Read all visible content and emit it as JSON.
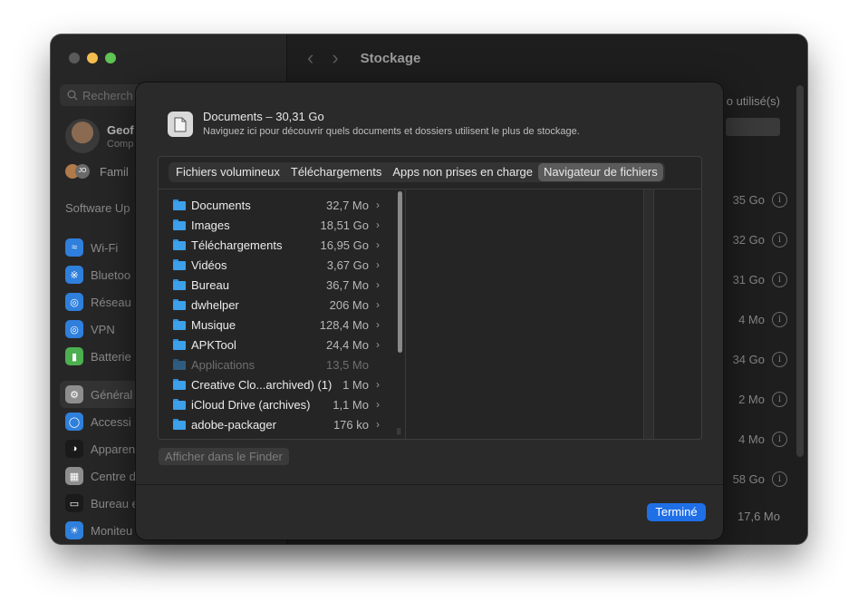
{
  "window": {
    "title": "Stockage"
  },
  "sidebar": {
    "search_placeholder": "Recherch",
    "profile_name": "Geof",
    "profile_sub": "Comp",
    "family_label": "Famil",
    "family_initials": "JO",
    "software_update": "Software Up",
    "items": [
      {
        "label": "Wi-Fi",
        "icon": "wifi-icon",
        "color": "#2f7fdc"
      },
      {
        "label": "Bluetoo",
        "icon": "bluetooth-icon",
        "color": "#2f7fdc"
      },
      {
        "label": "Réseau",
        "icon": "globe-icon",
        "color": "#2f7fdc"
      },
      {
        "label": "VPN",
        "icon": "vpn-icon",
        "color": "#2f7fdc"
      },
      {
        "label": "Batterie",
        "icon": "battery-icon",
        "color": "#4caf50"
      },
      {
        "label": "Général",
        "icon": "gear-icon",
        "color": "#8e8e8e"
      },
      {
        "label": "Accessi",
        "icon": "accessibility-icon",
        "color": "#2f7fdc"
      },
      {
        "label": "Apparen",
        "icon": "appearance-icon",
        "color": "#1a1a1a"
      },
      {
        "label": "Centre d",
        "icon": "control-center-icon",
        "color": "#8e8e8e"
      },
      {
        "label": "Bureau e",
        "icon": "desktop-icon",
        "color": "#1a1a1a"
      },
      {
        "label": "Moniteu",
        "icon": "display-icon",
        "color": "#2f7fdc"
      }
    ]
  },
  "main": {
    "header_text": "o utilisé(s)",
    "sizes": [
      "35 Go",
      "32 Go",
      "31 Go",
      "4 Mo",
      "34 Go",
      "2 Mo",
      "4 Mo",
      "58 Go"
    ],
    "bottom_size": "17,6 Mo"
  },
  "sheet": {
    "title": "Documents",
    "title_size": "30,31 Go",
    "subtitle": "Naviguez ici pour découvrir quels documents et dossiers utilisent le plus de stockage.",
    "tabs": [
      "Fichiers volumineux",
      "Téléchargements",
      "Apps non prises en charge",
      "Navigateur de fichiers"
    ],
    "rows": [
      {
        "name": "Documents",
        "size": "32,7 Mo",
        "chevron": "›"
      },
      {
        "name": "Images",
        "size": "18,51 Go",
        "chevron": "›"
      },
      {
        "name": "Téléchargements",
        "size": "16,95 Go",
        "chevron": "›"
      },
      {
        "name": "Vidéos",
        "size": "3,67 Go",
        "chevron": "›"
      },
      {
        "name": "Bureau",
        "size": "36,7 Mo",
        "chevron": "›"
      },
      {
        "name": "dwhelper",
        "size": "206 Mo",
        "chevron": "›"
      },
      {
        "name": "Musique",
        "size": "128,4 Mo",
        "chevron": "›"
      },
      {
        "name": "APKTool",
        "size": "24,4 Mo",
        "chevron": "›"
      },
      {
        "name": "Applications",
        "size": "13,5 Mo",
        "chevron": "",
        "dim": true
      },
      {
        "name": "Creative Clo...archived) (1)",
        "size": "1 Mo",
        "chevron": "›"
      },
      {
        "name": "iCloud Drive (archives)",
        "size": "1,1 Mo",
        "chevron": "›"
      },
      {
        "name": "adobe-packager",
        "size": "176 ko",
        "chevron": "›"
      }
    ],
    "finder_button": "Afficher dans le Finder",
    "done_button": "Terminé"
  },
  "colors": {
    "accent": "#1f6fe6",
    "folder": "#3ca0ea"
  }
}
